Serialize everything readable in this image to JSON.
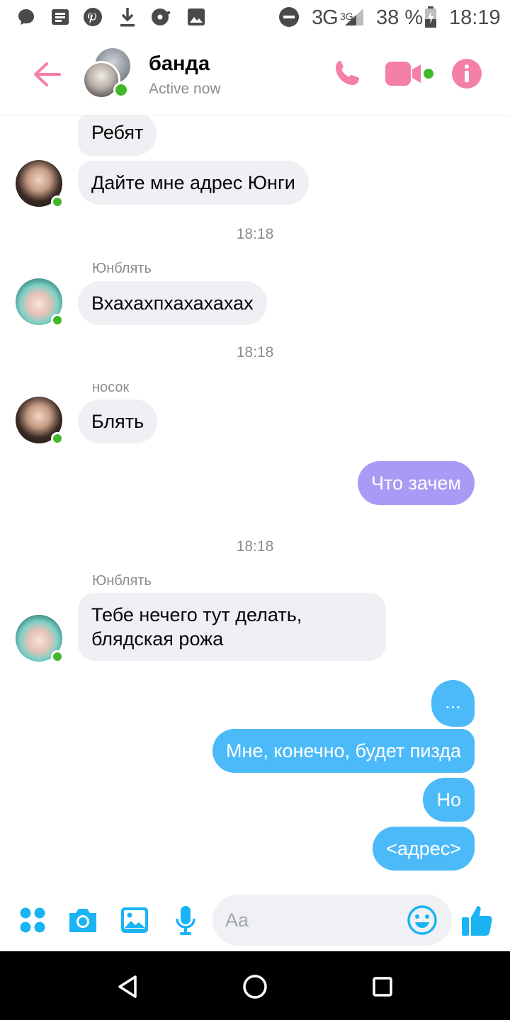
{
  "status_bar": {
    "network": "3G",
    "network_small": "3G",
    "battery": "38 %",
    "time": "18:19",
    "icons": [
      "messenger-icon",
      "news-icon",
      "pinterest-icon",
      "download-icon",
      "music-icon",
      "image-icon",
      "dnd-icon",
      "signal-icon",
      "battery-icon"
    ]
  },
  "header": {
    "title": "банда",
    "status": "Active now",
    "accent_color": "#f47fa8"
  },
  "messages": {
    "m1": "Ребят",
    "m2": "Дайте мне адрес Юнги",
    "ts1": "18:18",
    "sender2": "Юнблять",
    "m3": "Вхахахпхахахахах",
    "ts2": "18:18",
    "sender3": "носок",
    "m4": "Блять",
    "m5": "Что зачем",
    "ts3": "18:18",
    "sender4": "Юнблять",
    "m6": "Тебе нечего тут делать,\nблядская рожа",
    "m7": "...",
    "m8": "Мне, конечно, будет пизда",
    "m9": "Но",
    "m10": "<адрес>"
  },
  "composer": {
    "placeholder": "Aa",
    "accent_color": "#1ab4f5"
  },
  "colors": {
    "incoming_bubble": "#f0eff4",
    "outgoing_purple": "#a99bf5",
    "outgoing_blue": "#4cbaf9",
    "online": "#42b72a"
  }
}
